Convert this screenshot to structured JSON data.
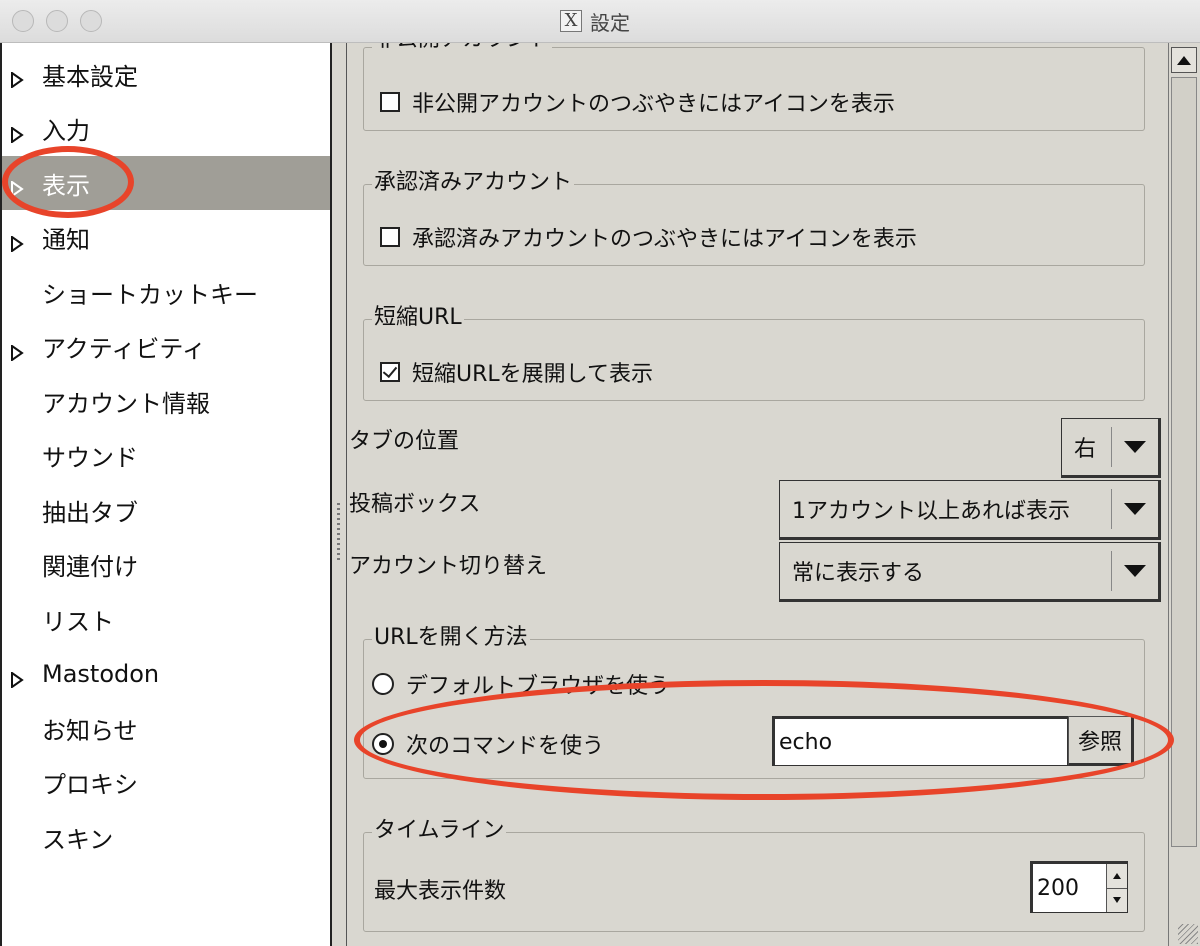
{
  "window": {
    "title": "設定",
    "title_icon": "x11-icon"
  },
  "tree": {
    "items": [
      {
        "label": "基本設定",
        "expandable": true,
        "selected": false
      },
      {
        "label": "入力",
        "expandable": true,
        "selected": false
      },
      {
        "label": "表示",
        "expandable": true,
        "selected": true
      },
      {
        "label": "通知",
        "expandable": true,
        "selected": false
      },
      {
        "label": "ショートカットキー",
        "expandable": false,
        "selected": false
      },
      {
        "label": "アクティビティ",
        "expandable": true,
        "selected": false
      },
      {
        "label": "アカウント情報",
        "expandable": false,
        "selected": false
      },
      {
        "label": "サウンド",
        "expandable": false,
        "selected": false
      },
      {
        "label": "抽出タブ",
        "expandable": false,
        "selected": false
      },
      {
        "label": "関連付け",
        "expandable": false,
        "selected": false
      },
      {
        "label": "リスト",
        "expandable": false,
        "selected": false
      },
      {
        "label": "Mastodon",
        "expandable": true,
        "selected": false
      },
      {
        "label": "お知らせ",
        "expandable": false,
        "selected": false
      },
      {
        "label": "プロキシ",
        "expandable": false,
        "selected": false
      },
      {
        "label": "スキン",
        "expandable": false,
        "selected": false
      }
    ]
  },
  "panel": {
    "private_account": {
      "legend": "非公開アカウント",
      "checkbox_label": "非公開アカウントのつぶやきにはアイコンを表示",
      "checked": false
    },
    "verified_account": {
      "legend": "承認済みアカウント",
      "checkbox_label": "承認済みアカウントのつぶやきにはアイコンを表示",
      "checked": false
    },
    "short_url": {
      "legend": "短縮URL",
      "checkbox_label": "短縮URLを展開して表示",
      "checked": true
    },
    "tab_position": {
      "label": "タブの位置",
      "value": "右"
    },
    "post_box": {
      "label": "投稿ボックス",
      "value": "1アカウント以上あれば表示"
    },
    "account_switch": {
      "label": "アカウント切り替え",
      "value": "常に表示する"
    },
    "url_open": {
      "legend": "URLを開く方法",
      "default_browser_label": "デフォルトブラウザを使う",
      "command_label": "次のコマンドを使う",
      "selected": "command",
      "command_value": "echo",
      "browse_label": "参照"
    },
    "timeline": {
      "legend": "タイムライン",
      "max_label": "最大表示件数",
      "max_value": "200"
    }
  },
  "annotation_color": "#e8442a"
}
